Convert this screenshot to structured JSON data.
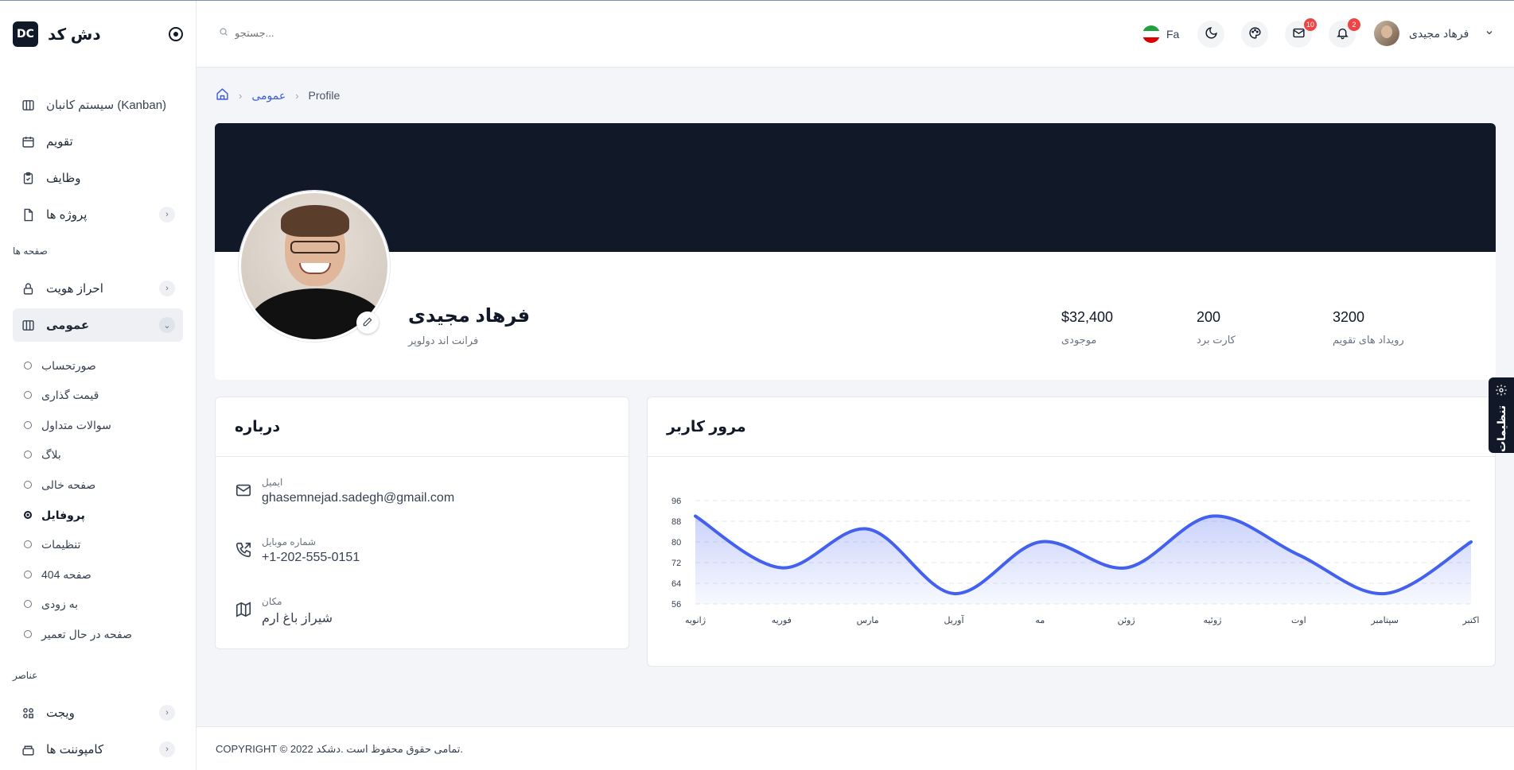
{
  "sidebar": {
    "brand_logo": "DC",
    "brand_name": "دش کد",
    "items_top": [
      {
        "label": "سیستم کانبان (Kanban)",
        "icon": "kanban-icon"
      },
      {
        "label": "تقویم",
        "icon": "calendar-icon"
      },
      {
        "label": "وظایف",
        "icon": "tasks-icon"
      },
      {
        "label": "پروژه ها",
        "icon": "file-icon"
      }
    ],
    "section_pages": "صفحه ها",
    "items_pages": [
      {
        "label": "احراز هویت",
        "icon": "lock-icon"
      },
      {
        "label": "عمومی",
        "icon": "columns-icon"
      }
    ],
    "sub_items": [
      "صورتحساب",
      "قیمت گذاری",
      "سوالات متداول",
      "بلاگ",
      "صفحه خالی",
      "پروفایل",
      "تنظیمات",
      "صفحه 404",
      "به زودی",
      "صفحه در حال تعمیر"
    ],
    "section_elements": "عناصر",
    "items_elements": [
      {
        "label": "ویجت",
        "icon": "widgets-icon"
      },
      {
        "label": "کامپوننت ها",
        "icon": "components-icon"
      }
    ]
  },
  "header": {
    "search_placeholder": "جستجو...",
    "lang": "Fa",
    "mail_count": "10",
    "notif_count": "2",
    "user_name": "فرهاد مجیدی"
  },
  "breadcrumb": {
    "parent": "عمومی",
    "current": "Profile"
  },
  "profile": {
    "name": "فرهاد مجیدی",
    "role": "فرانت اند دولوپر",
    "stats": [
      {
        "value": "$32,400",
        "label": "موجودی"
      },
      {
        "value": "200",
        "label": "کارت برد"
      },
      {
        "value": "3200",
        "label": "رویداد های تقویم"
      }
    ]
  },
  "about": {
    "title": "درباره",
    "email_label": "ایمیل",
    "email": "ghasemnejad.sadegh@gmail.com",
    "phone_label": "شماره موبایل",
    "phone": "+1-202-555-0151",
    "location_label": "مکان",
    "location": "شیراز باغ ارم"
  },
  "chart": {
    "title": "مرور کاربر"
  },
  "chart_data": {
    "type": "area",
    "categories": [
      "ژانویه",
      "فوریه",
      "مارس",
      "آوریل",
      "مه",
      "ژوئن",
      "ژوئیه",
      "اوت",
      "سپتامبر",
      "اکتبر"
    ],
    "values": [
      90,
      70,
      85,
      60,
      80,
      70,
      90,
      75,
      60,
      80
    ],
    "yticks": [
      56,
      64,
      72,
      80,
      88,
      96
    ],
    "ylim": [
      56,
      96
    ],
    "line_color": "#4361ee",
    "grid": true
  },
  "settings_tab": "تنظیمات",
  "footer": "COPYRIGHT © 2022 تمامی حقوق محفوظ است .دشکد.",
  "colors": {
    "dark": "#111827",
    "accent": "#3b5bdb",
    "badge": "#ef4444"
  }
}
